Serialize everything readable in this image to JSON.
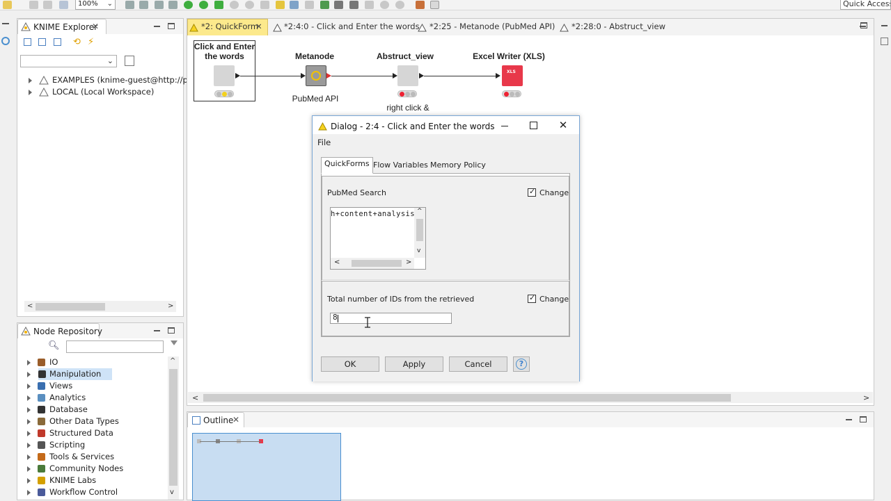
{
  "toolbar": {
    "zoom": "100%",
    "quick_access": "Quick Access"
  },
  "explorer": {
    "title": "KNIME Explorer",
    "items": [
      {
        "label": "EXAMPLES (knime-guest@http://pu"
      },
      {
        "label": "LOCAL (Local Workspace)"
      }
    ]
  },
  "node_repository": {
    "title": "Node Repository",
    "search_value": "",
    "items": [
      {
        "label": "IO"
      },
      {
        "label": "Manipulation"
      },
      {
        "label": "Views"
      },
      {
        "label": "Analytics"
      },
      {
        "label": "Database"
      },
      {
        "label": "Other Data Types"
      },
      {
        "label": "Structured Data"
      },
      {
        "label": "Scripting"
      },
      {
        "label": "Tools & Services"
      },
      {
        "label": "Community Nodes"
      },
      {
        "label": "KNIME Labs"
      },
      {
        "label": "Workflow Control"
      }
    ]
  },
  "editor": {
    "tabs": [
      {
        "label": "*2: QuickForm"
      },
      {
        "label": "*2:4:0 - Click and Enter the words"
      },
      {
        "label": "*2:25 - Metanode (PubMed API)"
      },
      {
        "label": "*2:28:0 - Abstruct_view"
      }
    ],
    "nodes": [
      {
        "label_line1": "Click and Enter",
        "label_line2": "the words",
        "caption": ""
      },
      {
        "label_line1": "Metanode",
        "label_line2": "",
        "caption": "PubMed API"
      },
      {
        "label_line1": "Abstruct_view",
        "label_line2": "",
        "caption": "right click &"
      },
      {
        "label_line1": "Excel Writer (XLS)",
        "label_line2": "",
        "caption": "",
        "icon_text": "XLS"
      }
    ]
  },
  "outline": {
    "title": "Outline"
  },
  "dialog": {
    "title": "Dialog - 2:4 - Click and Enter the words",
    "menu_file": "File",
    "tabs": [
      {
        "label": "QuickForms"
      },
      {
        "label": "Flow Variables"
      },
      {
        "label": "Memory Policy"
      }
    ],
    "group1": {
      "label": "PubMed Search",
      "change_label": "Change",
      "change_checked": true,
      "text_value": "h+content+analysis"
    },
    "group2": {
      "label": "Total number of IDs from the retrieved",
      "change_label": "Change",
      "change_checked": true,
      "input_value": "8"
    },
    "buttons": {
      "ok": "OK",
      "apply": "Apply",
      "cancel": "Cancel",
      "help": "?"
    }
  }
}
